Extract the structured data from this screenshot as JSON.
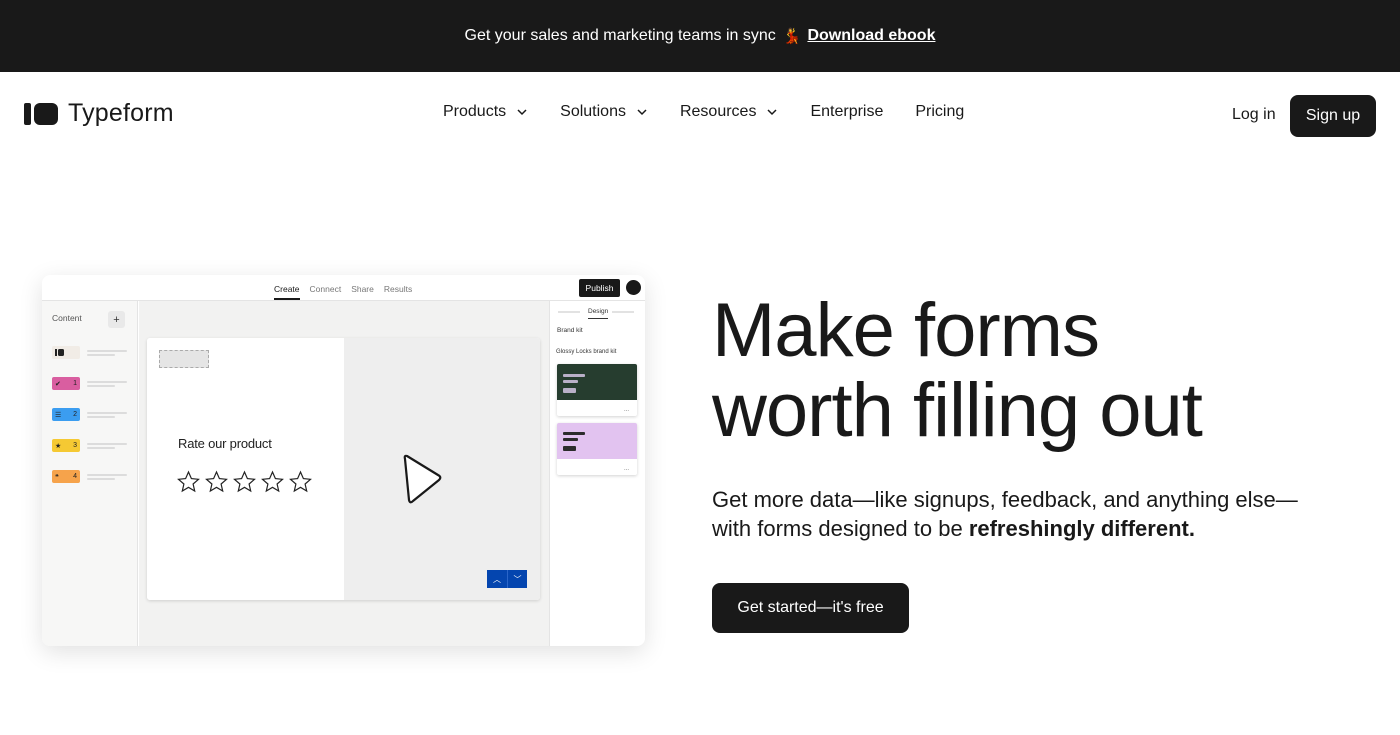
{
  "banner": {
    "text": "Get your sales and marketing teams in sync",
    "emoji": "💃",
    "link_label": "Download ebook"
  },
  "header": {
    "brand": "Typeform",
    "nav": [
      {
        "label": "Products",
        "has_dropdown": true
      },
      {
        "label": "Solutions",
        "has_dropdown": true
      },
      {
        "label": "Resources",
        "has_dropdown": true
      },
      {
        "label": "Enterprise",
        "has_dropdown": false
      },
      {
        "label": "Pricing",
        "has_dropdown": false
      }
    ],
    "login_label": "Log in",
    "signup_label": "Sign up"
  },
  "mockup": {
    "tabs": [
      "Create",
      "Connect",
      "Share",
      "Results"
    ],
    "active_tab": "Create",
    "publish_label": "Publish",
    "sidebar_title": "Content",
    "add_label": "+",
    "questions": [
      {
        "number": "",
        "color": "#f1ece6"
      },
      {
        "number": "1",
        "color": "#d95ea0"
      },
      {
        "number": "2",
        "color": "#3b9df0"
      },
      {
        "number": "3",
        "color": "#f5c933"
      },
      {
        "number": "4",
        "color": "#f6a34b"
      }
    ],
    "question_text": "Rate our product",
    "stars": 5,
    "right_tab": "Design",
    "brand_kit_label": "Brand kit",
    "brand_kit_name": "Glossy Locks brand kit",
    "themes": [
      {
        "color": "#263d2f",
        "line_color": "#b9b0c8"
      },
      {
        "color": "#e2c3f0",
        "line_color": "#2c2c2c"
      }
    ],
    "theme_more": "..."
  },
  "hero": {
    "title_line1": "Make forms",
    "title_line2": "worth filling out",
    "subtitle_plain": "Get more data—like signups, feedback, and anything else—with forms designed to be ",
    "subtitle_bold": "refreshingly different.",
    "cta_label": "Get started—it's free"
  }
}
